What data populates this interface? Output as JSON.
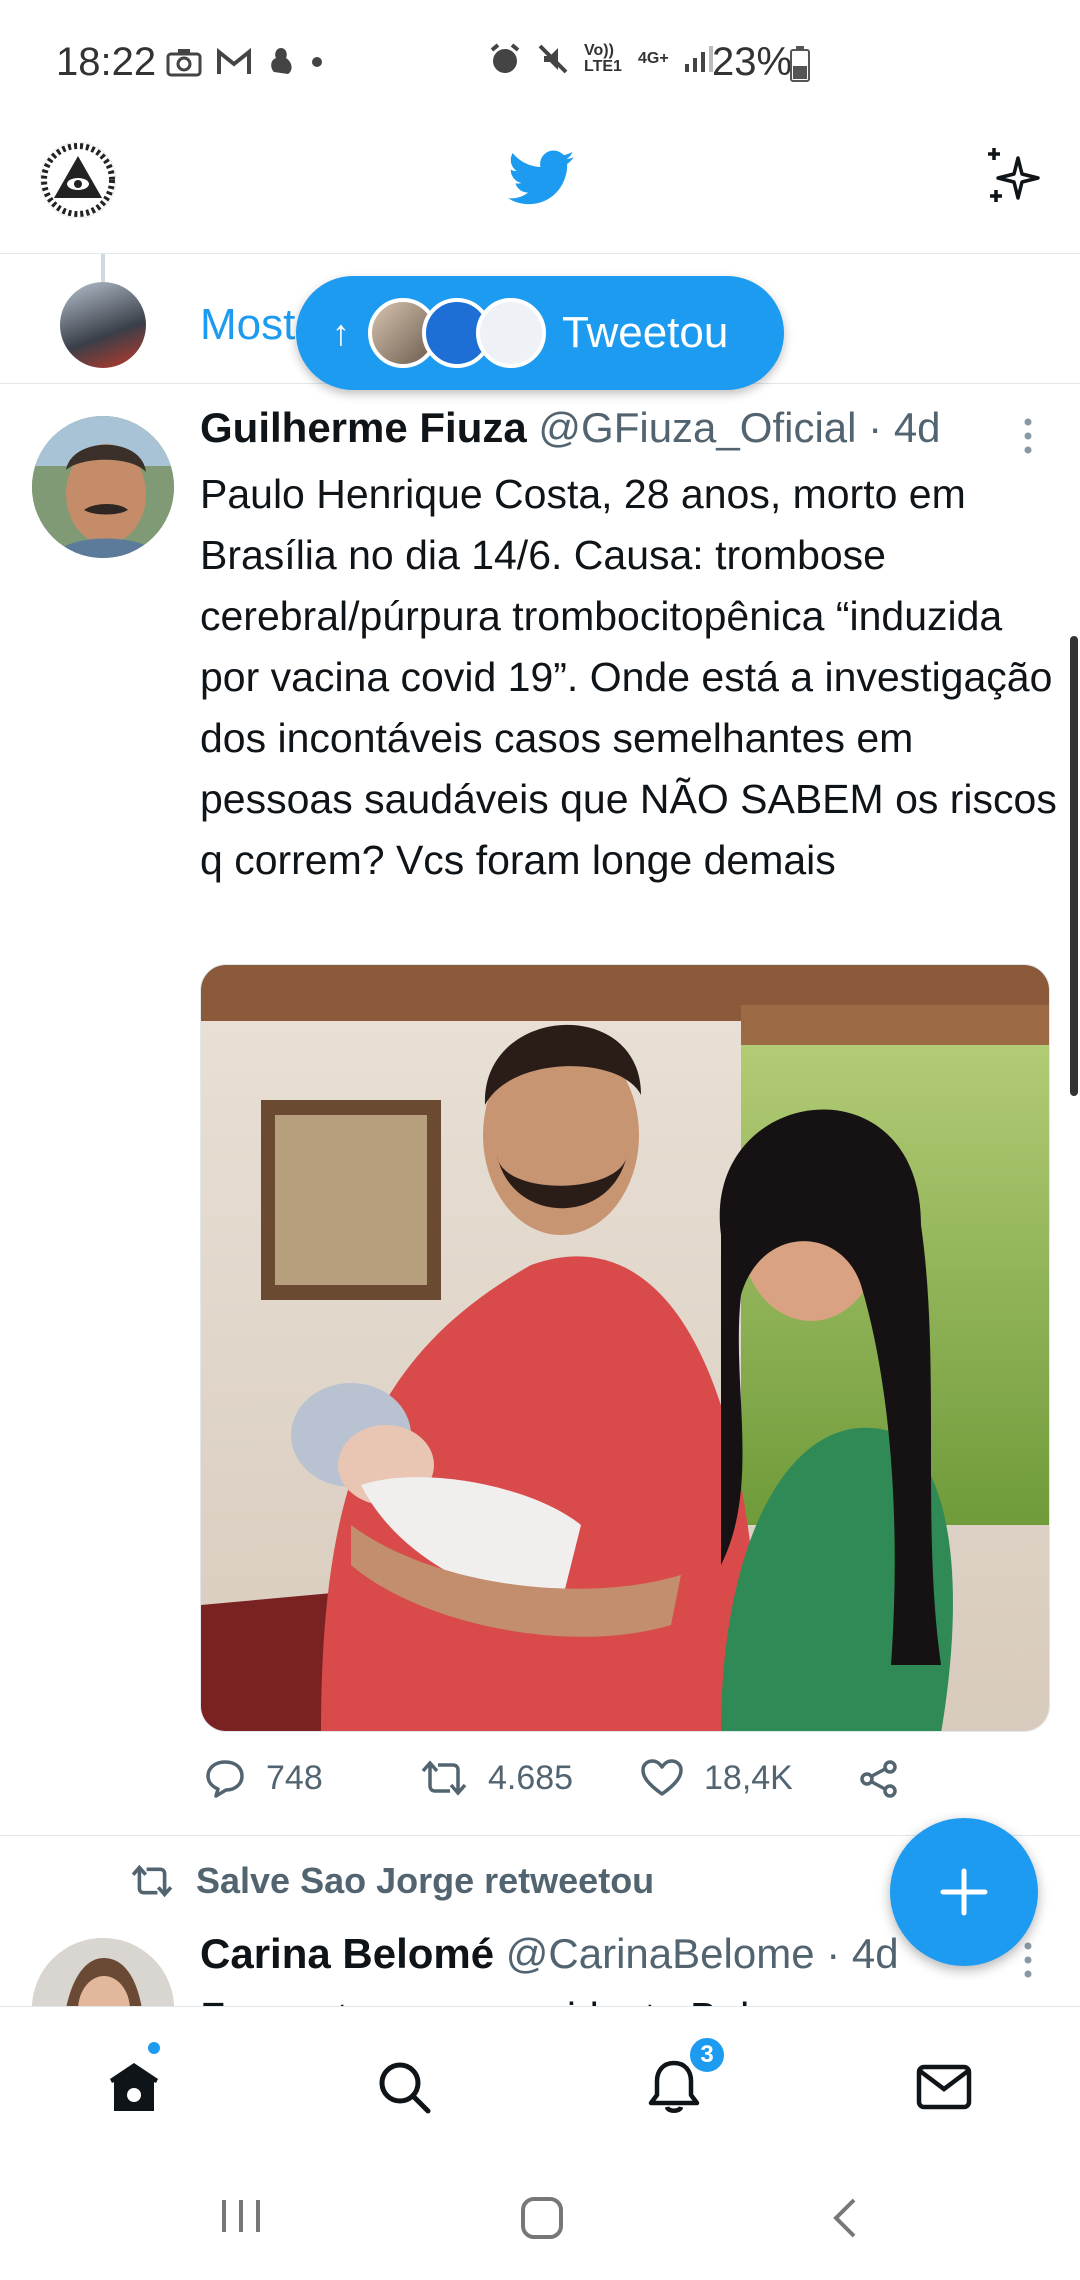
{
  "status_bar": {
    "time": "18:22",
    "network_label": "Vo)) LTE1",
    "network_type": "4G+",
    "battery": "23%"
  },
  "top_bar": {
    "logo_icon": "twitter-bird-icon",
    "sparkle_icon": "sparkle-icon"
  },
  "thread_row": {
    "text": "Most"
  },
  "new_tweets_pill": {
    "label": "Tweetou"
  },
  "tweet": {
    "name": "Guilherme Fiuza",
    "handle": "@GFiuza_Oficial",
    "separator": "·",
    "time": "4d",
    "text": "Paulo Henrique Costa, 28 anos, morto em Brasília no dia 14/6. Causa: trombose cerebral/púrpura trombocitopênica “induzida por vacina covid 19”. Onde está a investigação dos incontáveis casos semelhantes em pessoas saudáveis que NÃO SABEM os riscos q correm? Vcs foram longe demais",
    "replies": "748",
    "retweets": "4.685",
    "likes": "18,4K"
  },
  "retweet_context": {
    "label": "Salve Sao Jorge retweetou"
  },
  "tweet2": {
    "name": "Carina Belomé",
    "handle": "@CarinaBelome",
    "separator": "·",
    "time": "4d",
    "text": "Fomos tomar a presidente Bel..."
  },
  "bottom_nav": {
    "notifications_badge": "3"
  },
  "colors": {
    "accent": "#1d9bf0",
    "text_primary": "#0f1419",
    "text_secondary": "#536471"
  }
}
